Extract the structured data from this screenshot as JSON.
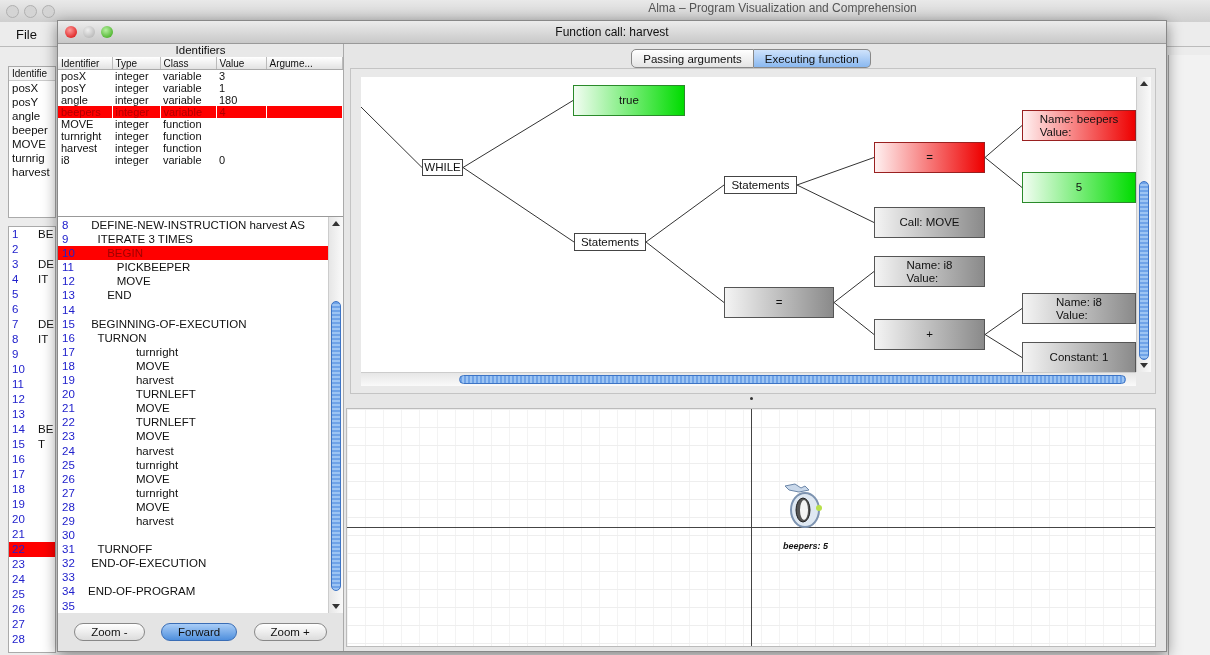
{
  "background_window": {
    "title": "Alma – Program Visualization and Comprehension",
    "menu": [
      "File"
    ],
    "identifiers_header": "Identifie",
    "identifiers": [
      "posX",
      "posY",
      "angle",
      "beeper",
      "MOVE",
      "turnrig",
      "harvest"
    ],
    "code_lines": [
      {
        "number": "1",
        "text": "BE",
        "selected": false
      },
      {
        "number": "2",
        "selected": false
      },
      {
        "number": "3",
        "text": "DE",
        "selected": false
      },
      {
        "number": "4",
        "text": "IT",
        "selected": false
      },
      {
        "number": "5",
        "selected": false
      },
      {
        "number": "6",
        "selected": false
      },
      {
        "number": "7",
        "text": "DE",
        "selected": false
      },
      {
        "number": "8",
        "text": "IT",
        "selected": false
      },
      {
        "number": "9",
        "selected": false
      },
      {
        "number": "10",
        "selected": false
      },
      {
        "number": "11",
        "selected": false
      },
      {
        "number": "12",
        "selected": false
      },
      {
        "number": "13",
        "selected": false
      },
      {
        "number": "14",
        "text": "BE",
        "selected": false
      },
      {
        "number": "15",
        "text": "T",
        "selected": false
      },
      {
        "number": "16",
        "selected": false
      },
      {
        "number": "17",
        "selected": false
      },
      {
        "number": "18",
        "selected": false
      },
      {
        "number": "19",
        "selected": false
      },
      {
        "number": "20",
        "selected": false
      },
      {
        "number": "21",
        "selected": false
      },
      {
        "number": "22",
        "selected": true
      },
      {
        "number": "23",
        "selected": false
      },
      {
        "number": "24",
        "selected": false
      },
      {
        "number": "25",
        "selected": false
      },
      {
        "number": "26",
        "selected": false
      },
      {
        "number": "27",
        "selected": false
      },
      {
        "number": "28",
        "selected": false
      }
    ]
  },
  "window": {
    "title": "Function call: harvest"
  },
  "identifiers_panel": {
    "title": "Identifiers",
    "columns": [
      "Identifier",
      "Type",
      "Class",
      "Value",
      "Argume..."
    ],
    "rows": [
      {
        "cells": [
          "posX",
          "integer",
          "variable",
          "3"
        ],
        "selected": false
      },
      {
        "cells": [
          "posY",
          "integer",
          "variable",
          "1"
        ],
        "selected": false
      },
      {
        "cells": [
          "angle",
          "integer",
          "variable",
          "180"
        ],
        "selected": false
      },
      {
        "cells": [
          "beepers",
          "integer",
          "variable",
          "4"
        ],
        "selected": true
      },
      {
        "cells": [
          "MOVE",
          "integer",
          "function"
        ],
        "selected": false
      },
      {
        "cells": [
          "turnright",
          "integer",
          "function"
        ],
        "selected": false
      },
      {
        "cells": [
          "harvest",
          "integer",
          "function"
        ],
        "selected": false
      },
      {
        "cells": [
          "i8",
          "integer",
          "variable",
          "0"
        ],
        "selected": false
      }
    ]
  },
  "code": [
    {
      "number": "8",
      "text": " DEFINE-NEW-INSTRUCTION harvest AS",
      "selected": false
    },
    {
      "number": "9",
      "text": "   ITERATE 3 TIMES",
      "selected": false
    },
    {
      "number": "10",
      "text": "      BEGIN",
      "selected": true
    },
    {
      "number": "11",
      "text": "         PICKBEEPER",
      "selected": false
    },
    {
      "number": "12",
      "text": "         MOVE",
      "selected": false
    },
    {
      "number": "13",
      "text": "      END",
      "selected": false
    },
    {
      "number": "14",
      "selected": false
    },
    {
      "number": "15",
      "text": " BEGINNING-OF-EXECUTION",
      "selected": false
    },
    {
      "number": "16",
      "text": "   TURNON",
      "selected": false
    },
    {
      "number": "17",
      "text": "               turnright",
      "selected": false
    },
    {
      "number": "18",
      "text": "               MOVE",
      "selected": false
    },
    {
      "number": "19",
      "text": "               harvest",
      "selected": false
    },
    {
      "number": "20",
      "text": "               TURNLEFT",
      "selected": false
    },
    {
      "number": "21",
      "text": "               MOVE",
      "selected": false
    },
    {
      "number": "22",
      "text": "               TURNLEFT",
      "selected": false
    },
    {
      "number": "23",
      "text": "               MOVE",
      "selected": false
    },
    {
      "number": "24",
      "text": "               harvest",
      "selected": false
    },
    {
      "number": "25",
      "text": "               turnright",
      "selected": false
    },
    {
      "number": "26",
      "text": "               MOVE",
      "selected": false
    },
    {
      "number": "27",
      "text": "               turnright",
      "selected": false
    },
    {
      "number": "28",
      "text": "               MOVE",
      "selected": false
    },
    {
      "number": "29",
      "text": "               harvest",
      "selected": false
    },
    {
      "number": "30",
      "selected": false
    },
    {
      "number": "31",
      "text": "   TURNOFF",
      "selected": false
    },
    {
      "number": "32",
      "text": " END-OF-EXECUTION",
      "selected": false
    },
    {
      "number": "33",
      "selected": false
    },
    {
      "number": "34",
      "text": "END-OF-PROGRAM",
      "selected": false
    },
    {
      "number": "35",
      "selected": false
    }
  ],
  "buttons": [
    {
      "label": "Zoom -",
      "primary": false
    },
    {
      "label": "Forward",
      "primary": true
    },
    {
      "label": "Zoom +",
      "primary": false
    }
  ],
  "tabs": [
    {
      "label": "Passing arguments",
      "selected": false
    },
    {
      "label": "Executing function",
      "selected": true
    }
  ],
  "tree": {
    "text": "WHILE",
    "kind": "plain",
    "children": [
      {
        "text": "true",
        "kind": "green"
      },
      {
        "text": "Statements",
        "kind": "plain",
        "children": [
          {
            "text": "Statements",
            "kind": "plain",
            "children": [
              {
                "text": "=",
                "kind": "red",
                "children": [
                  {
                    "text": "Name: beepers\nValue:",
                    "kind": "red"
                  },
                  {
                    "text": "5",
                    "kind": "green"
                  }
                ]
              },
              {
                "text": "Call: MOVE",
                "kind": "gray"
              }
            ]
          },
          {
            "text": "=",
            "kind": "gray",
            "children": [
              {
                "text": "Name: i8\nValue:",
                "kind": "gray"
              },
              {
                "text": "+",
                "kind": "gray",
                "children": [
                  {
                    "text": "Name: i8\nValue:",
                    "kind": "gray"
                  },
                  {
                    "text": "Constant: 1",
                    "kind": "gray"
                  }
                ]
              }
            ]
          }
        ]
      }
    ]
  },
  "world": {
    "robot_label": "beepers: 5"
  }
}
